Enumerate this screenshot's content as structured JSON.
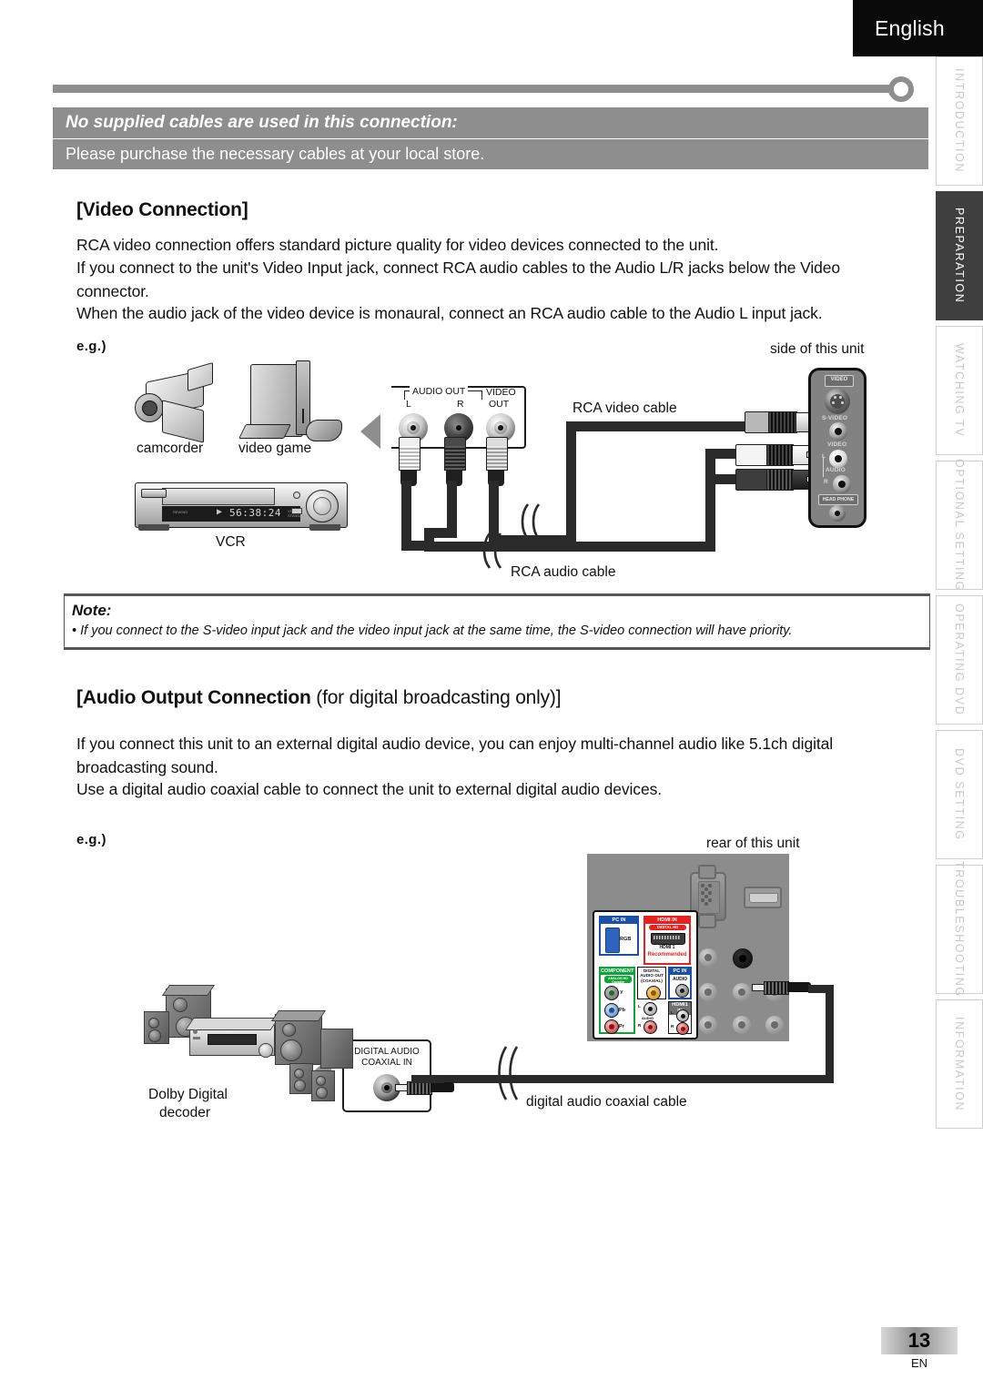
{
  "language_tab": "English",
  "banner": {
    "title": "No supplied cables are used in this connection:",
    "subtitle": "Please purchase the necessary cables at your local store."
  },
  "sections": [
    {
      "heading": "[Video Connection]",
      "paragraphs": [
        "RCA video connection offers standard picture quality for video devices connected to the unit.",
        "If you connect to the unit's  Video Input jack, connect RCA audio cables to the Audio L/R jacks below the Video connector.",
        "When the audio jack of the video device is monaural, connect an RCA audio cable to the Audio L input jack."
      ],
      "eg": "e.g.)"
    },
    {
      "heading_bold": "[Audio Output Connection",
      "heading_light": " (for digital broadcasting only)]",
      "paragraphs": [
        "If you connect this unit to an external digital audio device, you can enjoy multi-channel audio like 5.1ch digital broadcasting sound.",
        "Use a digital audio coaxial cable to connect the unit to external digital audio devices."
      ],
      "eg": "e.g.)"
    }
  ],
  "note": {
    "title": "Note:",
    "items": [
      "If you connect to the S-video input jack and the video input jack at the same time, the S-video connection will have priority."
    ]
  },
  "diagram_video": {
    "device_labels": [
      "camcorder",
      "video game",
      "VCR"
    ],
    "vcr_display": "56:38:24",
    "source_plate": {
      "audio_out": "AUDIO OUT",
      "left": "L",
      "right": "R",
      "video_out_line1": "VIDEO",
      "video_out_line2": "OUT"
    },
    "cable_labels": [
      "RCA video cable",
      "RCA audio cable"
    ],
    "unit_caption": "side of this unit",
    "side_panel": {
      "video_badge": "VIDEO",
      "s_video": "S-VIDEO",
      "video": "VIDEO",
      "audio": "AUDIO",
      "l": "L",
      "r": "R",
      "headphone": "HEAD PHONE"
    }
  },
  "diagram_audio": {
    "decoder_label_line1": "Dolby Digital",
    "decoder_label_line2": "decoder",
    "decoder_plate_line1": "DIGITAL AUDIO",
    "decoder_plate_line2": "COAXIAL IN",
    "cable_label": "digital audio coaxial cable",
    "unit_caption": "rear of this unit",
    "rear_panel": {
      "pc_in": "PC IN",
      "rgb": "RGB",
      "hdmi_in": "HDMI IN",
      "hdmi_sub": "DIGITAL HD Capable",
      "hdmi_port": "HDMI 1",
      "recommended": "Recommended",
      "component": "COMPONENT",
      "component_sub": "ANALOG HD Capable",
      "digital_audio_out_l1": "DIGITAL",
      "digital_audio_out_l2": "AUDIO OUT",
      "digital_audio_out_l3": "(COAXIAL)",
      "pc_in_audio_title": "PC IN",
      "pc_in_audio": "AUDIO",
      "hdmi1_in": "HDMI1 IN",
      "y": "Y",
      "pb": "Pb",
      "pr": "Pr",
      "audio": "AUDIO",
      "l": "L",
      "r": "R"
    }
  },
  "side_tabs": [
    {
      "label": "INTRODUCTION",
      "active": false
    },
    {
      "label": "PREPARATION",
      "active": true
    },
    {
      "label": "WATCHING TV",
      "active": false
    },
    {
      "label": "OPTIONAL  SETTING",
      "active": false
    },
    {
      "label": "OPERATING  DVD",
      "active": false
    },
    {
      "label": "DVD  SETTING",
      "active": false
    },
    {
      "label": "TROUBLESHOOTING",
      "active": false
    },
    {
      "label": "INFORMATION",
      "active": false
    }
  ],
  "footer": {
    "page_number": "13",
    "lang_code": "EN"
  },
  "colors": {
    "banner_gray": "#8e8e8e",
    "tab_active": "#3f3f3f",
    "hdmi_red": "#e8201f",
    "pc_blue": "#1b50a8",
    "component_green": "#11a23a",
    "panel_gray": "#8c8c8c"
  }
}
